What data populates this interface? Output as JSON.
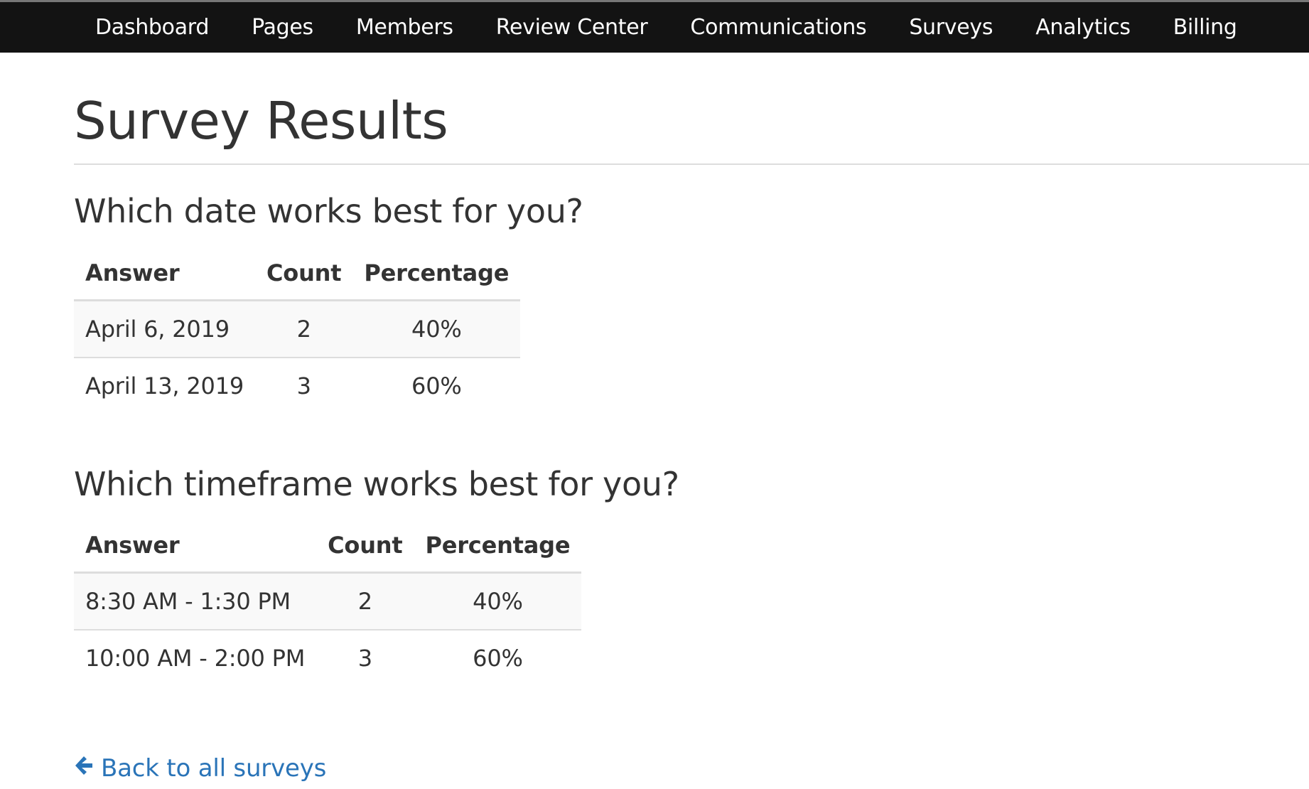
{
  "nav": {
    "items": [
      "Dashboard",
      "Pages",
      "Members",
      "Review Center",
      "Communications",
      "Surveys",
      "Analytics",
      "Billing"
    ]
  },
  "page": {
    "title": "Survey Results"
  },
  "questions": [
    {
      "title": "Which date works best for you?",
      "headers": [
        "Answer",
        "Count",
        "Percentage"
      ],
      "rows": [
        {
          "answer": "April 6, 2019",
          "count": "2",
          "percentage": "40%"
        },
        {
          "answer": "April 13, 2019",
          "count": "3",
          "percentage": "60%"
        }
      ]
    },
    {
      "title": "Which timeframe works best for you?",
      "headers": [
        "Answer",
        "Count",
        "Percentage"
      ],
      "rows": [
        {
          "answer": "8:30 AM - 1:30 PM",
          "count": "2",
          "percentage": "40%"
        },
        {
          "answer": "10:00 AM - 2:00 PM",
          "count": "3",
          "percentage": "60%"
        }
      ]
    }
  ],
  "back_link": {
    "label": "Back to all surveys",
    "icon": "arrow-left-icon"
  },
  "colors": {
    "navbar_bg": "#131313",
    "link": "#2a74b8",
    "text": "#333333",
    "stripe": "#f9f9f9",
    "border": "#dddddd"
  }
}
